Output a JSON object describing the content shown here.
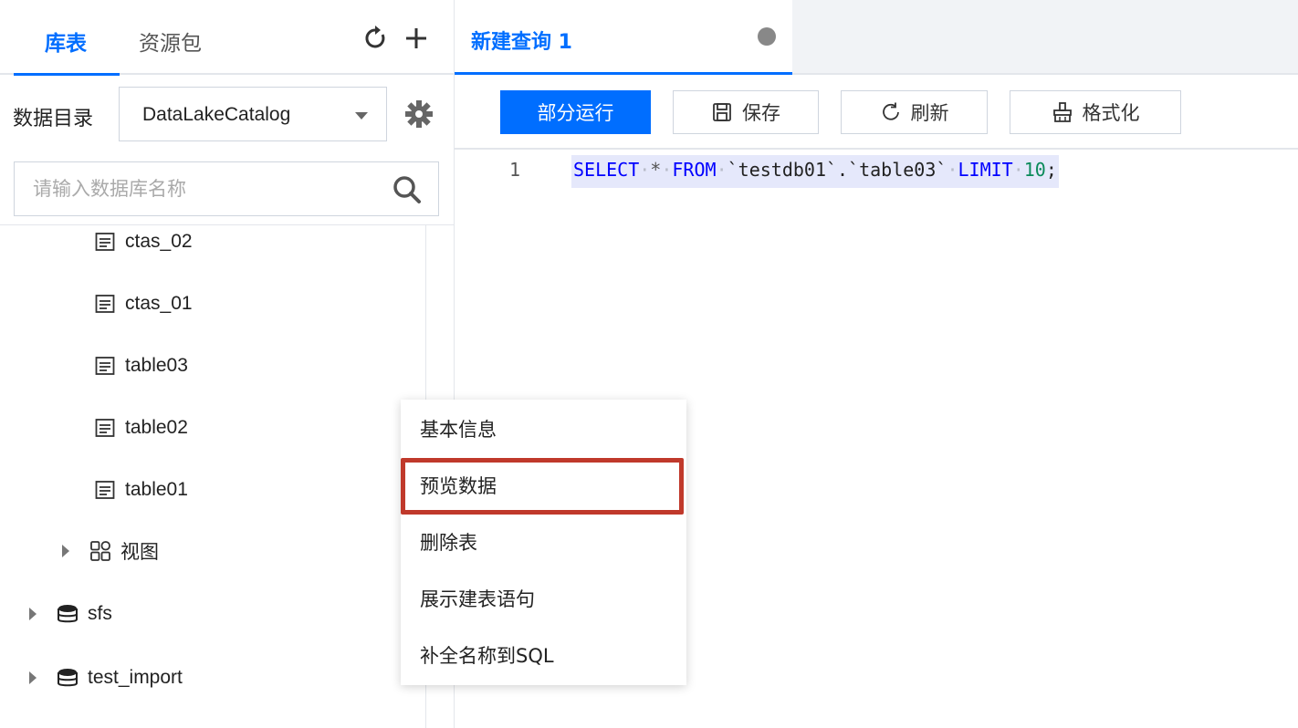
{
  "left_tabs": {
    "tables": "库表",
    "resources": "资源包"
  },
  "catalog": {
    "label": "数据目录",
    "selected": "DataLakeCatalog"
  },
  "search": {
    "placeholder": "请输入数据库名称"
  },
  "tree": {
    "tables": [
      "ctas_02",
      "ctas_01",
      "table03",
      "table02",
      "table01"
    ],
    "views_label": "视图",
    "databases": [
      "sfs",
      "test_import"
    ]
  },
  "editor_tab": {
    "title": "新建查询 1"
  },
  "toolbar": {
    "run_partial": "部分运行",
    "save": "保存",
    "refresh": "刷新",
    "format": "格式化"
  },
  "editor": {
    "line_number": "1",
    "kw_select": "SELECT",
    "star": "*",
    "kw_from": "FROM",
    "table_ref": "`testdb01`.`table03`",
    "kw_limit": "LIMIT",
    "limit_value": "10",
    "terminator": ";"
  },
  "context_menu": {
    "items": [
      "基本信息",
      "预览数据",
      "删除表",
      "展示建表语句",
      "补全名称到SQL"
    ],
    "highlighted_item": "预览数据",
    "highlight_color": "#c0392b"
  },
  "colors": {
    "accent": "#006eff",
    "keyword": "#0000ff",
    "number": "#0a8a5a"
  }
}
